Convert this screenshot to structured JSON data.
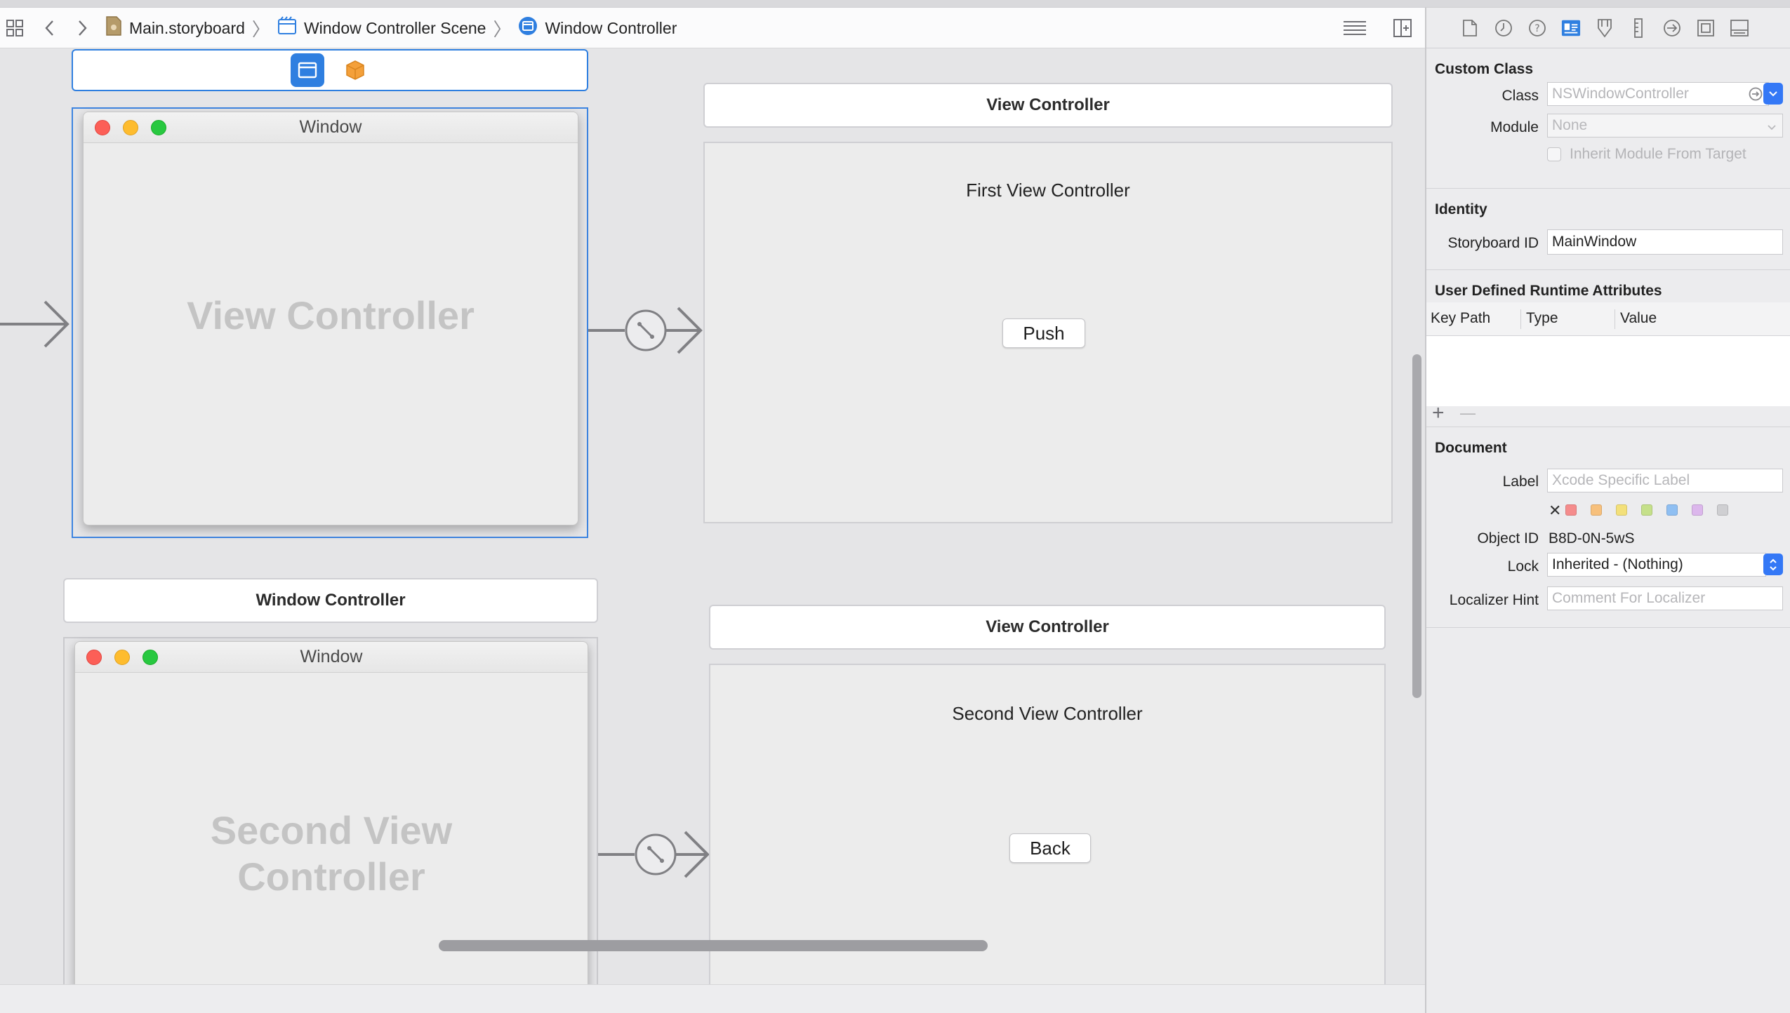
{
  "jumpbar": {
    "crumbs": [
      "Main.storyboard",
      "Window Controller Scene",
      "Window Controller"
    ],
    "icons": {
      "related": "grid-icon",
      "back": "chevron-left-icon",
      "forward": "chevron-right-icon",
      "file": "storyboard-file-icon",
      "scene": "scene-icon",
      "controller": "window-controller-icon",
      "editor_options": "lines-icon",
      "add_editor": "split-editor-icon"
    }
  },
  "canvas": {
    "scene1": {
      "dock_icons": [
        "window-controller-icon",
        "cube-icon"
      ],
      "window_title": "Window",
      "placeholder": "View Controller"
    },
    "scene2": {
      "header": "View Controller",
      "title": "First View Controller",
      "button": "Push"
    },
    "scene3": {
      "header": "Window Controller",
      "window_title": "Window",
      "placeholder_line1": "Second View",
      "placeholder_line2": "Controller"
    },
    "scene4": {
      "header": "View Controller",
      "title": "Second View Controller",
      "button": "Back"
    }
  },
  "inspector": {
    "tabs": [
      "file-icon",
      "history-icon",
      "help-icon",
      "identity-icon",
      "attributes-icon",
      "size-icon",
      "connections-icon",
      "bindings-icon",
      "effects-icon"
    ],
    "custom_class": {
      "title": "Custom Class",
      "class_label": "Class",
      "class_placeholder": "NSWindowController",
      "module_label": "Module",
      "module_placeholder": "None",
      "inherit_label": "Inherit Module From Target"
    },
    "identity": {
      "title": "Identity",
      "storyboard_id_label": "Storyboard ID",
      "storyboard_id_value": "MainWindow"
    },
    "runtime": {
      "title": "User Defined Runtime Attributes",
      "columns": [
        "Key Path",
        "Type",
        "Value"
      ],
      "add": "+",
      "remove": "—"
    },
    "document": {
      "title": "Document",
      "label_label": "Label",
      "label_placeholder": "Xcode Specific Label",
      "swatch_colors": [
        "#f58c8c",
        "#f7c07c",
        "#f3e07a",
        "#c5e08a",
        "#8fbff2",
        "#dcb7ec",
        "#cfcfd2"
      ],
      "clear": "✕",
      "object_id_label": "Object ID",
      "object_id_value": "B8D-0N-5wS",
      "lock_label": "Lock",
      "lock_value": "Inherited - (Nothing)",
      "hint_label": "Localizer Hint",
      "hint_placeholder": "Comment For Localizer"
    }
  }
}
